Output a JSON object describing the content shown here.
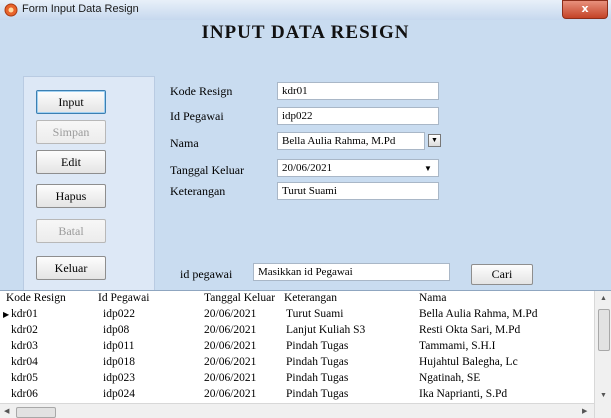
{
  "window": {
    "title": "Form Input Data Resign",
    "close_label": "x"
  },
  "form": {
    "title": "INPUT DATA RESIGN"
  },
  "buttons": {
    "input": "Input",
    "simpan": "Simpan",
    "edit": "Edit",
    "hapus": "Hapus",
    "batal": "Batal",
    "keluar": "Keluar",
    "cari": "Cari"
  },
  "fields": {
    "kode_resign": {
      "label": "Kode Resign",
      "value": "kdr01"
    },
    "id_pegawai": {
      "label": "Id Pegawai",
      "value": "idp022"
    },
    "nama": {
      "label": "Nama",
      "value": "Bella Aulia Rahma, M.Pd"
    },
    "tanggal_keluar": {
      "label": "Tanggal Keluar",
      "value": "20/06/2021"
    },
    "keterangan": {
      "label": "Keterangan",
      "value": "Turut Suami"
    }
  },
  "search": {
    "label": "id pegawai",
    "value": "Masikkan id Pegawai"
  },
  "grid": {
    "columns": [
      "Kode Resign",
      "Id Pegawai",
      "Tanggal Keluar",
      "Keterangan",
      "Nama"
    ],
    "rows": [
      [
        "kdr01",
        "idp022",
        "20/06/2021",
        "Turut Suami",
        "Bella Aulia Rahma, M.Pd"
      ],
      [
        "kdr02",
        "idp08",
        "20/06/2021",
        "Lanjut Kuliah S3",
        "Resti Okta Sari, M.Pd"
      ],
      [
        "kdr03",
        "idp011",
        "20/06/2021",
        "Pindah Tugas",
        "Tammami, S.H.I"
      ],
      [
        "kdr04",
        "idp018",
        "20/06/2021",
        "Pindah Tugas",
        "Hujahtul Balegha, Lc"
      ],
      [
        "kdr05",
        "idp023",
        "20/06/2021",
        "Pindah Tugas",
        "Ngatinah, SE"
      ],
      [
        "kdr06",
        "idp024",
        "20/06/2021",
        "Pindah Tugas",
        "Ika Naprianti, S.Pd"
      ]
    ]
  },
  "colors": {
    "form_bg": "#c9dcf0",
    "panel_bg": "#dde8f6",
    "close_red": "#c44327"
  }
}
